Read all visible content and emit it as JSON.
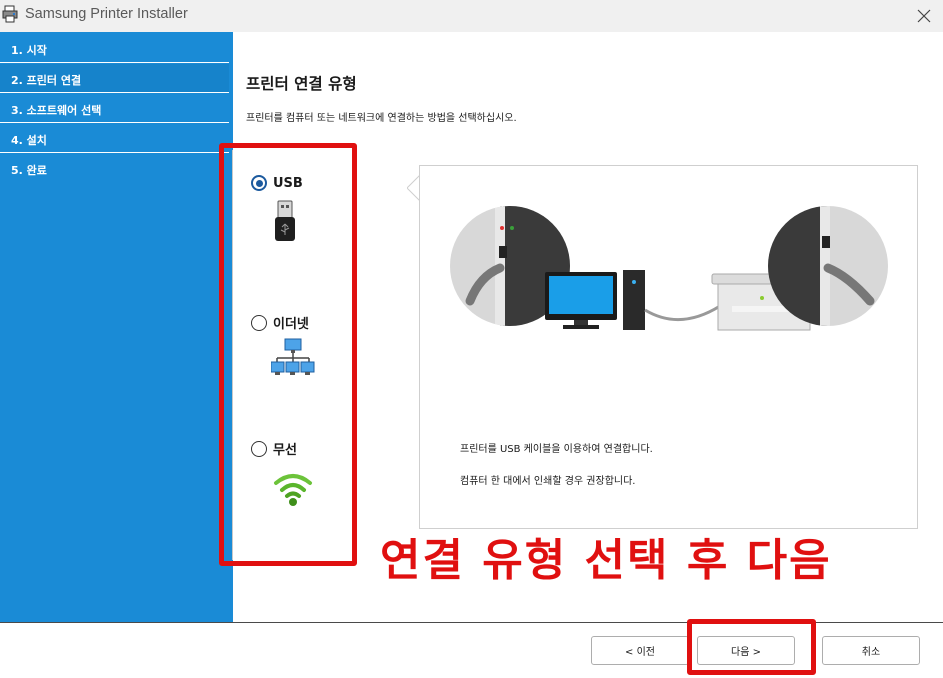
{
  "window": {
    "title": "Samsung Printer Installer"
  },
  "sidebar": {
    "steps": [
      {
        "label": "1. 시작"
      },
      {
        "label": "2. 프린터 연결"
      },
      {
        "label": "3. 소프트웨어 선택"
      },
      {
        "label": "4. 설치"
      },
      {
        "label": "5. 완료"
      }
    ],
    "active_step": 2
  },
  "main": {
    "heading": "프린터 연결 유형",
    "description": "프린터를 컴퓨터 또는 네트워크에 연결하는 방법을 선택하십시오.",
    "options": [
      {
        "label": "USB",
        "selected": true,
        "icon": "usb-icon"
      },
      {
        "label": "이더넷",
        "selected": false,
        "icon": "ethernet-network-icon"
      },
      {
        "label": "무선",
        "selected": false,
        "icon": "wifi-icon"
      }
    ],
    "info": {
      "line1": "프린터를 USB 케이블을 이용하여 연결합니다.",
      "line2": "컴퓨터 한 대에서 인쇄할 경우 권장합니다."
    }
  },
  "annotation": {
    "text": "연결 유형 선택 후 다음"
  },
  "buttons": {
    "back": "< 이전",
    "next": "다음 >",
    "cancel": "취소"
  },
  "colors": {
    "sidebar": "#1a8bd6",
    "annotation_red": "#e01010",
    "radio_selected": "#1c5a9e"
  }
}
